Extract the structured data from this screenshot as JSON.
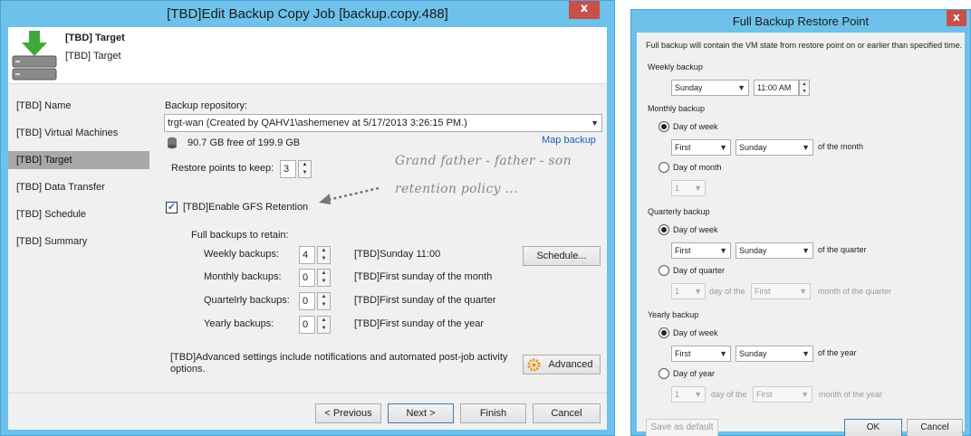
{
  "main_window": {
    "title": "[TBD]Edit Backup Copy Job [backup.copy.488]",
    "close_label": "x",
    "header": {
      "title": "[TBD] Target",
      "subtitle": "[TBD] Target"
    },
    "nav": [
      "[TBD] Name",
      "[TBD] Virtual Machines",
      "[TBD] Target",
      "[TBD] Data Transfer",
      "[TBD] Schedule",
      "[TBD] Summary"
    ],
    "nav_active_index": 2,
    "repo_label": "Backup repository:",
    "repo_value": "trgt-wan (Created by QAHV1\\ashemenev at 5/17/2013 3:26:15 PM.)",
    "free_space": "90.7 GB free of 199.9 GB",
    "map_backup": "Map backup",
    "restore_points_label": "Restore points to keep:",
    "restore_points_value": "3",
    "gfs_label": "[TBD]Enable GFS Retention",
    "gfs_checked": true,
    "annotation_line1": "Grand father - father - son",
    "annotation_line2": "retention policy ...",
    "full_backups_label": "Full backups to retain:",
    "retention": [
      {
        "label": "Weekly backups:",
        "value": "4",
        "desc": "[TBD]Sunday 11:00"
      },
      {
        "label": "Monthly backups:",
        "value": "0",
        "desc": "[TBD]First sunday of the month"
      },
      {
        "label": "Quartelrly backups:",
        "value": "0",
        "desc": "[TBD]First sunday of the quarter"
      },
      {
        "label": "Yearly backups:",
        "value": "0",
        "desc": "[TBD]First sunday of the year"
      }
    ],
    "schedule_button": "Schedule...",
    "advanced_text": "[TBD]Advanced settings include notifications and automated post-job activity options.",
    "advanced_button": "Advanced",
    "buttons": {
      "previous": "< Previous",
      "next": "Next >",
      "finish": "Finish",
      "cancel": "Cancel"
    }
  },
  "restore_window": {
    "title": "Full Backup Restore Point",
    "close_label": "x",
    "description": "Full backup will contain the VM state from restore point on or earlier than specified time.",
    "weekly": {
      "label": "Weekly backup",
      "day": "Sunday",
      "time": "11:00 AM"
    },
    "monthly": {
      "label": "Monthly backup",
      "opt1": "Day of week",
      "opt1_selected": true,
      "ordinal": "First",
      "weekday": "Sunday",
      "suffix": "of the month",
      "opt2": "Day of month",
      "day_value": "1"
    },
    "quarterly": {
      "label": "Quarterly backup",
      "opt1": "Day of week",
      "opt1_selected": true,
      "ordinal": "First",
      "weekday": "Sunday",
      "suffix": "of the quarter",
      "opt2": "Day of quarter",
      "day_value": "1",
      "day_of_the": "day of the",
      "month_value": "First",
      "month_suffix": "month of the quarter"
    },
    "yearly": {
      "label": "Yearly backup",
      "opt1": "Day of week",
      "opt1_selected": true,
      "ordinal": "First",
      "weekday": "Sunday",
      "suffix": "of the year",
      "opt2": "Day of year",
      "day_value": "1",
      "day_of_the": "day of the",
      "month_value": "First",
      "month_suffix": "month of the year"
    },
    "buttons": {
      "save_default": "Save as default",
      "ok": "OK",
      "cancel": "Cancel"
    }
  },
  "colors": {
    "title_bar": "#6ec1ea",
    "close": "#c7504b",
    "nav_active": "#a8a8a8",
    "link": "#1a5fb4"
  }
}
